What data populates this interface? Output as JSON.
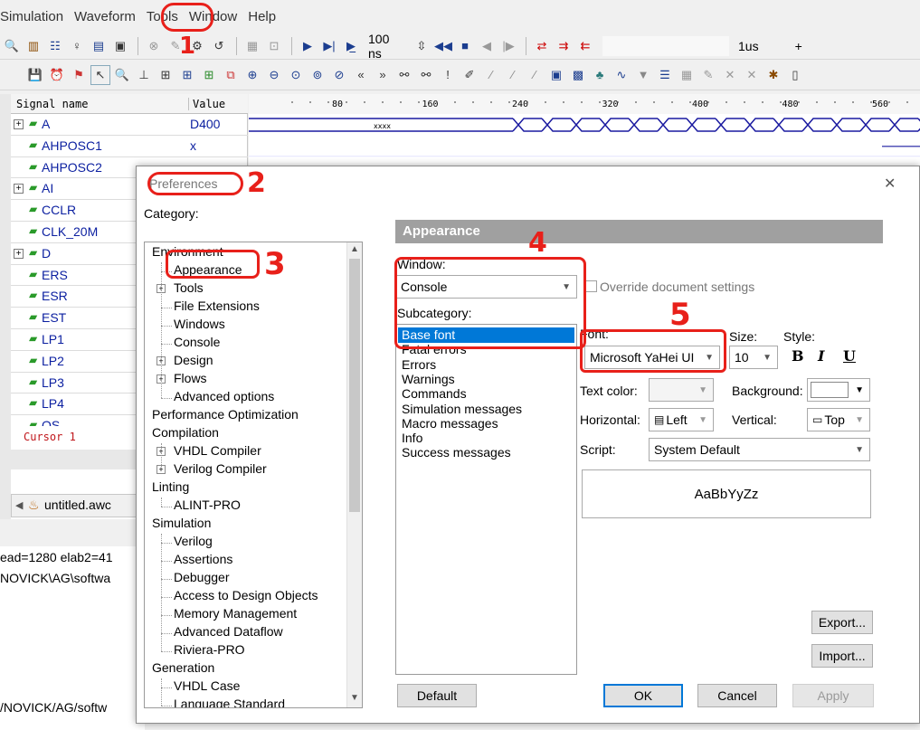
{
  "menubar": [
    "Simulation",
    "Waveform",
    "Tools",
    "Window",
    "Help"
  ],
  "toolbar1": {
    "time_value": "100 ns",
    "time_scale": "1us",
    "plus": "+"
  },
  "waveform": {
    "header_name": "Signal name",
    "header_value": "Value",
    "ticks": [
      "80",
      "160",
      "240",
      "320",
      "400",
      "480",
      "560"
    ],
    "signals": [
      {
        "name": "A",
        "value": "D400",
        "expand": true
      },
      {
        "name": "AHPOSC1",
        "value": "x",
        "expand": false
      },
      {
        "name": "AHPOSC2",
        "value": "",
        "expand": false
      },
      {
        "name": "AI",
        "value": "",
        "expand": true
      },
      {
        "name": "CCLR",
        "value": "",
        "expand": false
      },
      {
        "name": "CLK_20M",
        "value": "",
        "expand": false
      },
      {
        "name": "D",
        "value": "",
        "expand": true
      },
      {
        "name": "ERS",
        "value": "",
        "expand": false
      },
      {
        "name": "ESR",
        "value": "",
        "expand": false
      },
      {
        "name": "EST",
        "value": "",
        "expand": false
      },
      {
        "name": "LP1",
        "value": "",
        "expand": false
      },
      {
        "name": "LP2",
        "value": "",
        "expand": false
      },
      {
        "name": "LP3",
        "value": "",
        "expand": false
      },
      {
        "name": "LP4",
        "value": "",
        "expand": false
      },
      {
        "name": "OS",
        "value": "",
        "expand": false
      }
    ],
    "xxxx": "xxxx",
    "cursor": "Cursor 1",
    "tab": "untitled.awc"
  },
  "console_lines": [
    "ead=1280 elab2=41",
    "NOVICK\\AG\\softwa",
    "/NOVICK/AG/softw"
  ],
  "dialog": {
    "title": "Preferences",
    "category_label": "Category:",
    "tree": [
      {
        "label": "Environment",
        "level": 0,
        "plus": false
      },
      {
        "label": "Appearance",
        "level": 1,
        "plus": false
      },
      {
        "label": "Tools",
        "level": 1,
        "plus": true
      },
      {
        "label": "File Extensions",
        "level": 1,
        "plus": false
      },
      {
        "label": "Windows",
        "level": 1,
        "plus": false
      },
      {
        "label": "Console",
        "level": 1,
        "plus": false
      },
      {
        "label": "Design",
        "level": 1,
        "plus": true
      },
      {
        "label": "Flows",
        "level": 1,
        "plus": true
      },
      {
        "label": "Advanced options",
        "level": 1,
        "plus": false
      },
      {
        "label": "Performance Optimization",
        "level": 0,
        "plus": false
      },
      {
        "label": "Compilation",
        "level": 0,
        "plus": false
      },
      {
        "label": "VHDL Compiler",
        "level": 1,
        "plus": true
      },
      {
        "label": "Verilog Compiler",
        "level": 1,
        "plus": true
      },
      {
        "label": "Linting",
        "level": 0,
        "plus": false
      },
      {
        "label": "ALINT-PRO",
        "level": 1,
        "plus": false
      },
      {
        "label": "Simulation",
        "level": 0,
        "plus": false
      },
      {
        "label": "Verilog",
        "level": 1,
        "plus": false
      },
      {
        "label": "Assertions",
        "level": 1,
        "plus": false
      },
      {
        "label": "Debugger",
        "level": 1,
        "plus": false
      },
      {
        "label": "Access to Design Objects",
        "level": 1,
        "plus": false
      },
      {
        "label": "Memory Management",
        "level": 1,
        "plus": false
      },
      {
        "label": "Advanced Dataflow",
        "level": 1,
        "plus": false
      },
      {
        "label": "Riviera-PRO",
        "level": 1,
        "plus": false
      },
      {
        "label": "Generation",
        "level": 0,
        "plus": false
      },
      {
        "label": "VHDL Case",
        "level": 1,
        "plus": false
      },
      {
        "label": "Language Standard",
        "level": 1,
        "plus": false
      }
    ],
    "section_title": "Appearance",
    "window_label": "Window:",
    "window_value": "Console",
    "override_label": "Override document settings",
    "subcategory_label": "Subcategory:",
    "subcategories": [
      "Base font",
      "Fatal errors",
      "Errors",
      "Warnings",
      "Commands",
      "Simulation messages",
      "Macro messages",
      "Info",
      "Success messages"
    ],
    "font_label": "Font:",
    "font_value": "Microsoft YaHei UI",
    "size_label": "Size:",
    "size_value": "10",
    "style_label": "Style:",
    "style_b": "B",
    "style_i": "I",
    "style_u": "U",
    "text_color_label": "Text color:",
    "background_label": "Background:",
    "horizontal_label": "Horizontal:",
    "horizontal_value": "Left",
    "vertical_label": "Vertical:",
    "vertical_value": "Top",
    "script_label": "Script:",
    "script_value": "System Default",
    "preview_text": "AaBbYyZz",
    "export_btn": "Export...",
    "import_btn": "Import...",
    "default_btn": "Default",
    "ok_btn": "OK",
    "cancel_btn": "Cancel",
    "apply_btn": "Apply",
    "close_glyph": "✕"
  },
  "annotations": {
    "n1": "1",
    "n2": "2",
    "n3": "3",
    "n4": "4",
    "n5": "5"
  },
  "colors": {
    "annotation": "#e8201a",
    "section_header": "#a0a0a0",
    "selection": "#0078d7",
    "signal_text": "#0b1fa0",
    "wave": "#1a1aa0"
  }
}
